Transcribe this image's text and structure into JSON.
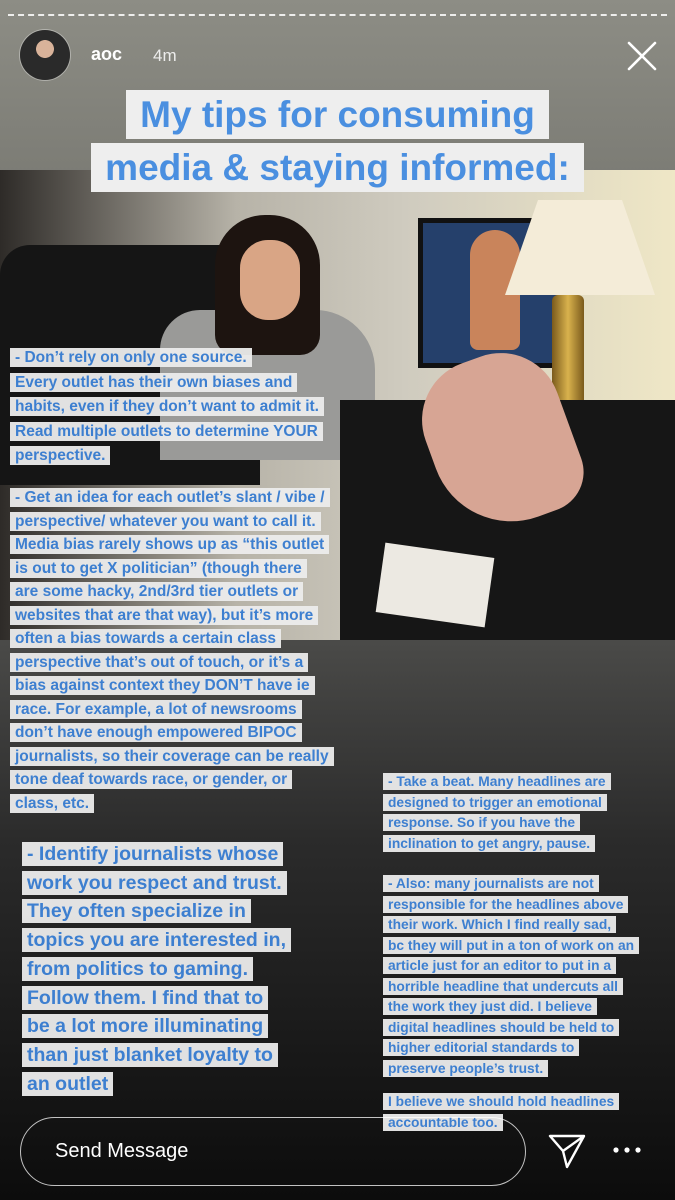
{
  "header": {
    "username": "aoc",
    "time": "4m"
  },
  "title_lines": [
    "My tips for consuming",
    "media & staying informed:"
  ],
  "tips": {
    "tip1_lines": [
      "- Don’t rely on only one source.",
      "Every outlet has their own biases and",
      "habits, even if they don’t want to admit it.",
      "Read multiple outlets to determine YOUR",
      "perspective."
    ],
    "tip2_lines": [
      "- Get an idea for each outlet’s slant / vibe /",
      "perspective/ whatever you want to call it.",
      "Media bias rarely shows up as “this outlet",
      "is out to get X politician” (though there",
      "are some hacky, 2nd/3rd tier outlets or",
      "websites that are that way), but it’s more",
      "often a bias towards a certain class",
      "perspective that’s out of touch, or it’s a",
      "bias against context they DON’T have ie",
      "race. For example, a lot of newsrooms",
      "don’t have enough empowered BIPOC",
      "journalists, so their coverage can be really",
      "tone deaf towards race, or gender, or",
      "class, etc."
    ],
    "tip3_lines": [
      "- Identify journalists whose",
      "work you respect and trust.",
      "They often specialize in",
      "topics you are interested in,",
      "from politics to gaming.",
      "Follow them. I find that to",
      "be a lot more illuminating",
      "than just blanket loyalty to",
      "an outlet"
    ],
    "tip4_lines": [
      "- Take a beat. Many headlines are",
      "designed to trigger an emotional",
      "response. So if you have the",
      "inclination to get angry, pause."
    ],
    "tip5_lines": [
      "- Also: many journalists are not",
      "responsible for the headlines above",
      "their work. Which I find really sad,",
      "bc they will put in a ton of work on an",
      "article just for an editor to put in a",
      "horrible headline that undercuts all",
      "the work they just did. I believe",
      "digital headlines should be held to",
      "higher editorial standards to",
      "preserve people’s trust."
    ],
    "tip6_lines": [
      "I believe we should hold headlines",
      "accountable too."
    ]
  },
  "footer": {
    "message_placeholder": "Send Message"
  },
  "icons": {
    "close": "close-icon",
    "send": "paper-plane-icon",
    "more": "more-dots-icon"
  },
  "colors": {
    "accent_text": "#4a8fe0",
    "highlight_bg": "#ececec"
  }
}
